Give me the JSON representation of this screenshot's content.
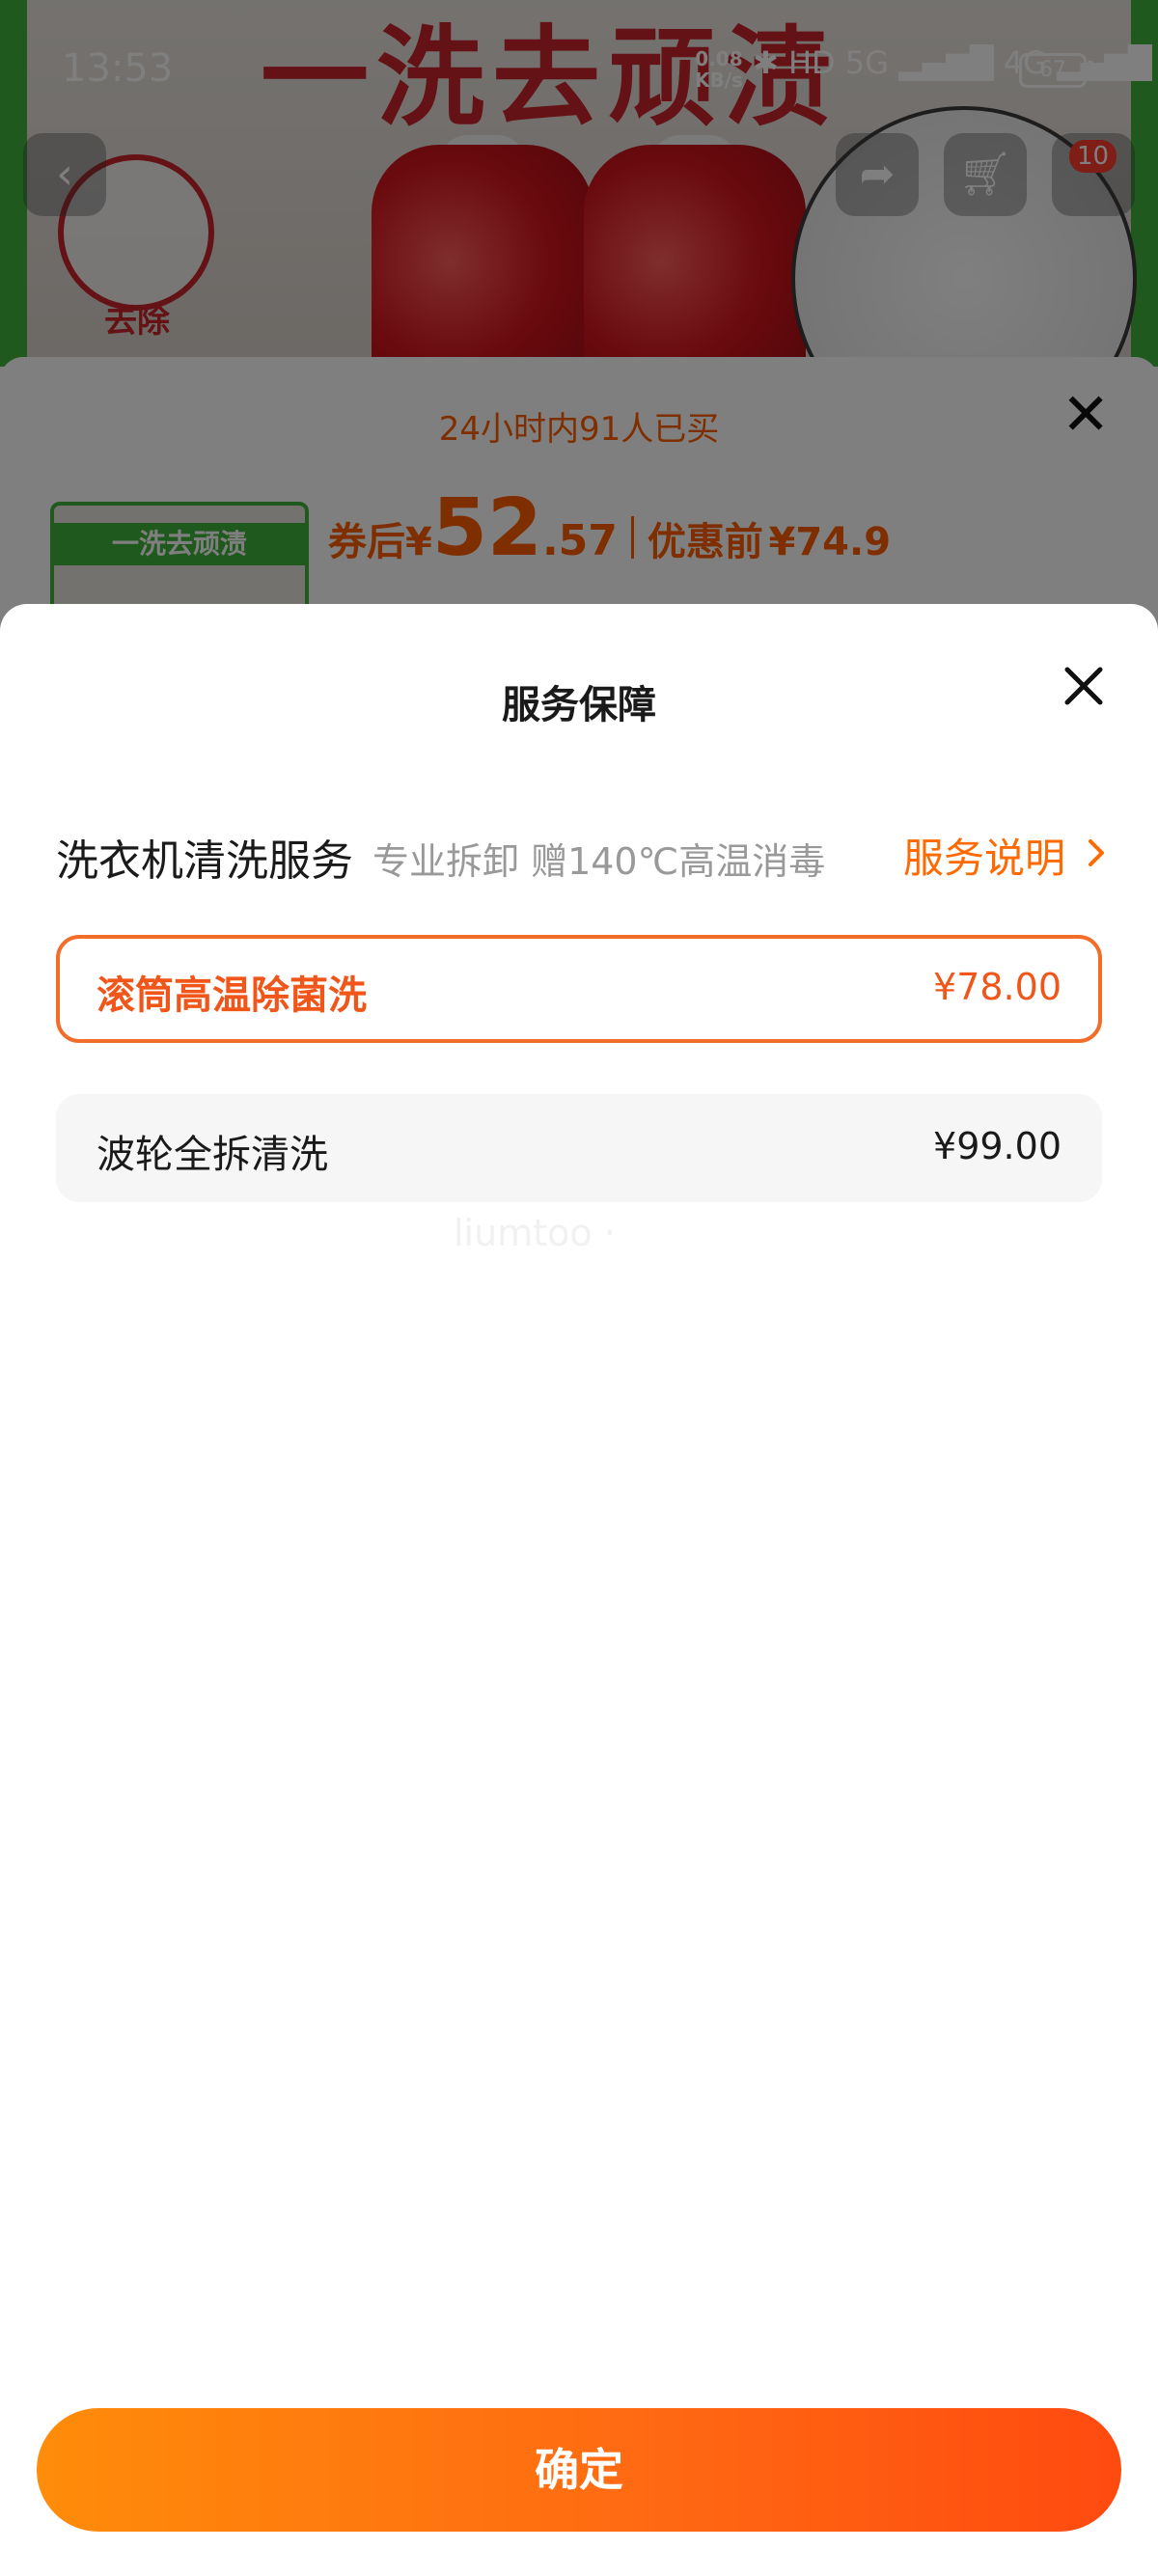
{
  "status_bar": {
    "time": "13:53",
    "net_speed": "0.08\nKB/s",
    "icons": "✱ HD 5G ▂▄▆█ 4G ▂▄▆█",
    "battery": "67"
  },
  "hero": {
    "title": "一洗去顽渍",
    "badge_text": "去除",
    "cart_count": "10"
  },
  "product_sheet": {
    "sold_text": "24小时内91人已买",
    "thumb_text": "一洗去顽渍",
    "price_prefix": "券后",
    "currency": "¥",
    "price_int": "52",
    "price_dec": ".57",
    "original_label": "优惠前",
    "original_price": "¥74.9"
  },
  "service_sheet": {
    "title": "服务保障",
    "service_name": "洗衣机清洗服务",
    "service_desc": "专业拆卸 赠140℃高温消毒",
    "service_link": "服务说明",
    "options": [
      {
        "label": "滚筒高温除菌洗",
        "price": "¥78.00",
        "selected": true
      },
      {
        "label": "波轮全拆清洗",
        "price": "¥99.00",
        "selected": false
      }
    ],
    "watermark": "liumtoo ·",
    "confirm_label": "确定"
  },
  "colors": {
    "accent": "#ff6a00",
    "selected_border": "#f26c2a",
    "brand_red": "#c8242b"
  }
}
